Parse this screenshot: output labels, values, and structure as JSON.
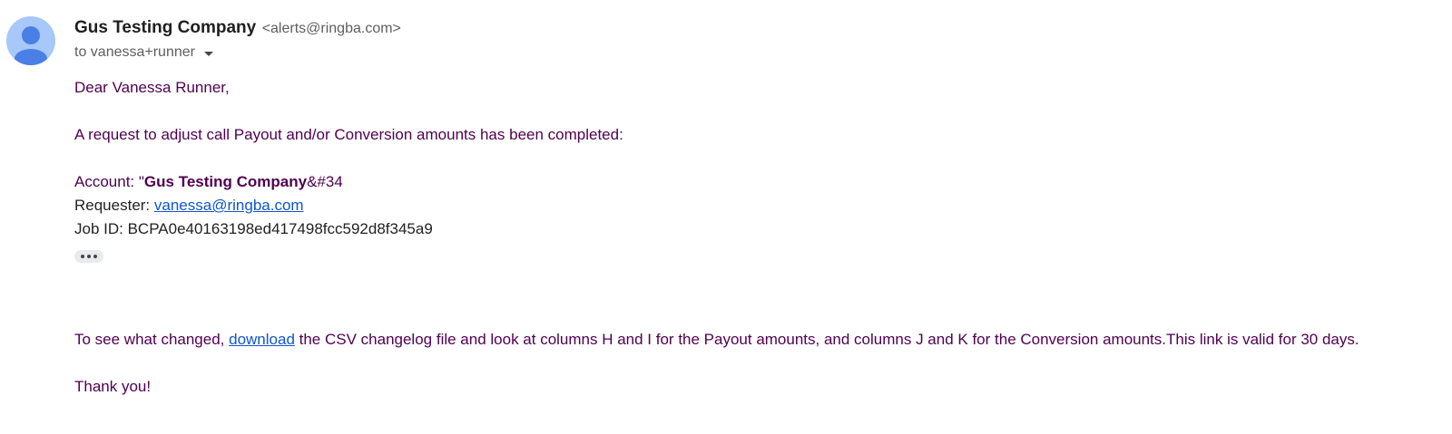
{
  "sender": {
    "name": "Gus Testing Company",
    "email": "<alerts@ringba.com>"
  },
  "recipient": {
    "to_text": "to vanessa+runner"
  },
  "body": {
    "greeting": "Dear Vanessa Runner,",
    "intro": "A request to adjust call Payout and/or Conversion amounts has been completed:",
    "account_prefix": "Account: \"",
    "account_name": "Gus Testing Company",
    "account_suffix": "&#34",
    "requester_label": "Requester: ",
    "requester_email": "vanessa@ringba.com",
    "job_id_text": "Job ID: BCPA0e40163198ed417498fcc592d8f345a9",
    "changelog_prefix": "To see what changed, ",
    "changelog_link": "download",
    "changelog_suffix": " the CSV changelog file and look at columns H and I for the Payout amounts, and columns J and K for the Conversion amounts.This link is valid for 30 days.",
    "closing": "Thank you!"
  },
  "icons": {
    "avatar": "person-avatar-icon",
    "dropdown": "chevron-down-icon",
    "trimmed": "more-horiz-icon"
  },
  "colors": {
    "body_text": "#500050",
    "link": "#1155cc",
    "avatar_bg": "#a8c7fa",
    "avatar_fg": "#4285f4"
  }
}
